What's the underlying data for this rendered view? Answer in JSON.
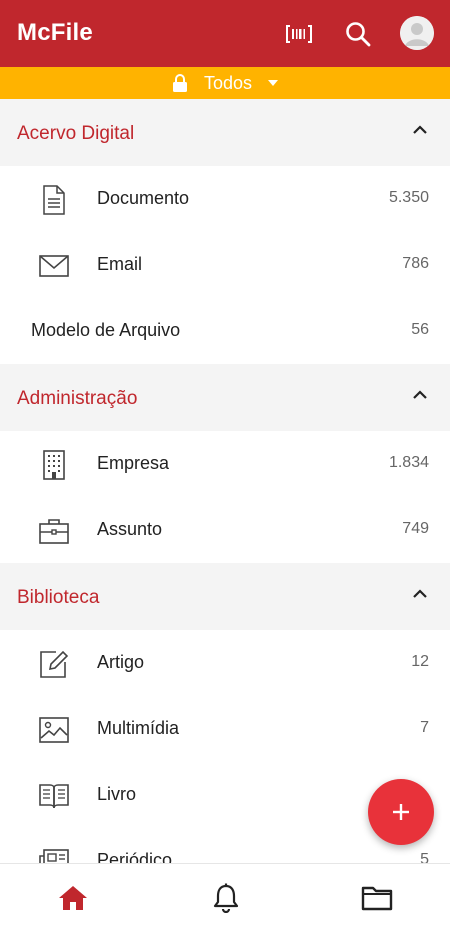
{
  "app": {
    "title": "McFile"
  },
  "filter": {
    "label": "Todos"
  },
  "sections": [
    {
      "title": "Acervo Digital",
      "items": [
        {
          "label": "Documento",
          "count": "5.350",
          "icon": "document-icon"
        },
        {
          "label": "Email",
          "count": "786",
          "icon": "email-icon"
        },
        {
          "label": "Modelo de Arquivo",
          "count": "56",
          "icon": ""
        }
      ]
    },
    {
      "title": "Administração",
      "items": [
        {
          "label": "Empresa",
          "count": "1.834",
          "icon": "building-icon"
        },
        {
          "label": "Assunto",
          "count": "749",
          "icon": "briefcase-icon"
        }
      ]
    },
    {
      "title": "Biblioteca",
      "items": [
        {
          "label": "Artigo",
          "count": "12",
          "icon": "edit-icon"
        },
        {
          "label": "Multimídia",
          "count": "7",
          "icon": "image-icon"
        },
        {
          "label": "Livro",
          "count": "",
          "icon": "book-icon"
        },
        {
          "label": "Periódico",
          "count": "5",
          "icon": "newspaper-icon"
        }
      ]
    }
  ],
  "colors": {
    "primary": "#c0272d",
    "accent": "#ffb300",
    "fab": "#e8323a"
  },
  "bottom_nav": [
    "home-icon",
    "bell-icon",
    "folder-icon"
  ]
}
